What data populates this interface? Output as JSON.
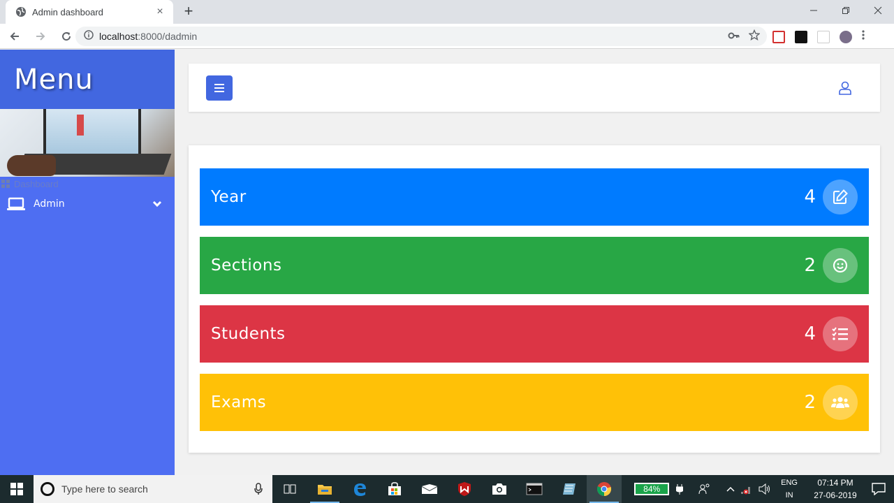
{
  "browser": {
    "tab_title": "Admin dashboard",
    "tab_close": "×",
    "new_tab": "+",
    "url_host": "localhost",
    "url_rest": ":8000/dadmin"
  },
  "sidebar": {
    "title": "Menu",
    "crumb": "Dashboard",
    "items": [
      {
        "label": "Admin",
        "icon": "laptop-icon"
      }
    ]
  },
  "stats": [
    {
      "label": "Year",
      "count": "4",
      "color": "#007bff",
      "icon": "edit-icon"
    },
    {
      "label": "Sections",
      "count": "2",
      "color": "#28a745",
      "icon": "smile-icon"
    },
    {
      "label": "Students",
      "count": "4",
      "color": "#dc3545",
      "icon": "list-check-icon"
    },
    {
      "label": "Exams",
      "count": "2",
      "color": "#ffc107",
      "icon": "users-icon"
    }
  ],
  "taskbar": {
    "search_placeholder": "Type here to search",
    "battery": "84%",
    "lang_top": "ENG",
    "lang_bottom": "IN",
    "time": "07:14 PM",
    "date": "27-06-2019"
  },
  "colors": {
    "sidebar": "#4e6ef2",
    "sidebar_header": "#4267e0",
    "accent": "#4267e0"
  }
}
